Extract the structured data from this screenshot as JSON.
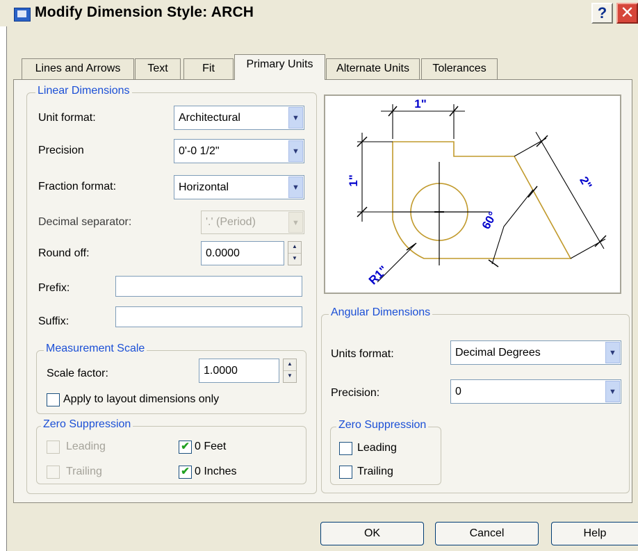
{
  "window": {
    "title": "Modify Dimension Style: ARCH",
    "help_glyph": "?",
    "close_glyph": "✕"
  },
  "tabs": [
    {
      "label": "Lines and Arrows",
      "active": false
    },
    {
      "label": "Text",
      "active": false
    },
    {
      "label": "Fit",
      "active": false
    },
    {
      "label": "Primary Units",
      "active": true
    },
    {
      "label": "Alternate Units",
      "active": false
    },
    {
      "label": "Tolerances",
      "active": false
    }
  ],
  "linear": {
    "title": "Linear Dimensions",
    "unit_format_label": "Unit format:",
    "unit_format_value": "Architectural",
    "precision_label": "Precision",
    "precision_value": "0'-0 1/2\"",
    "fraction_format_label": "Fraction format:",
    "fraction_format_value": "Horizontal",
    "decimal_separator_label": "Decimal separator:",
    "decimal_separator_value": "'.' (Period)",
    "round_off_label": "Round off:",
    "round_off_value": "0.0000",
    "prefix_label": "Prefix:",
    "prefix_value": "",
    "suffix_label": "Suffix:",
    "suffix_value": "",
    "measurement_scale": {
      "title": "Measurement Scale",
      "scale_factor_label": "Scale factor:",
      "scale_factor_value": "1.0000",
      "apply_layout_label": "Apply to layout dimensions only",
      "apply_layout_checked": false
    },
    "zero_suppression": {
      "title": "Zero Suppression",
      "leading_label": "Leading",
      "trailing_label": "Trailing",
      "feet_label": "0 Feet",
      "inches_label": "0 Inches",
      "leading_checked": false,
      "trailing_checked": false,
      "feet_checked": true,
      "inches_checked": true
    }
  },
  "preview": {
    "dim_top": "1\"",
    "dim_left": "1\"",
    "dim_right": "2\"",
    "angle": "60°",
    "radius": "R1\"",
    "part_color": "#c19a2c",
    "dim_color": "#000000",
    "text_color": "#0000cc"
  },
  "angular": {
    "title": "Angular Dimensions",
    "units_format_label": "Units format:",
    "units_format_value": "Decimal Degrees",
    "precision_label": "Precision:",
    "precision_value": "0",
    "zero_suppression": {
      "title": "Zero Suppression",
      "leading_label": "Leading",
      "trailing_label": "Trailing",
      "leading_checked": false,
      "trailing_checked": false
    }
  },
  "buttons": {
    "ok": "OK",
    "cancel": "Cancel",
    "help": "Help"
  }
}
